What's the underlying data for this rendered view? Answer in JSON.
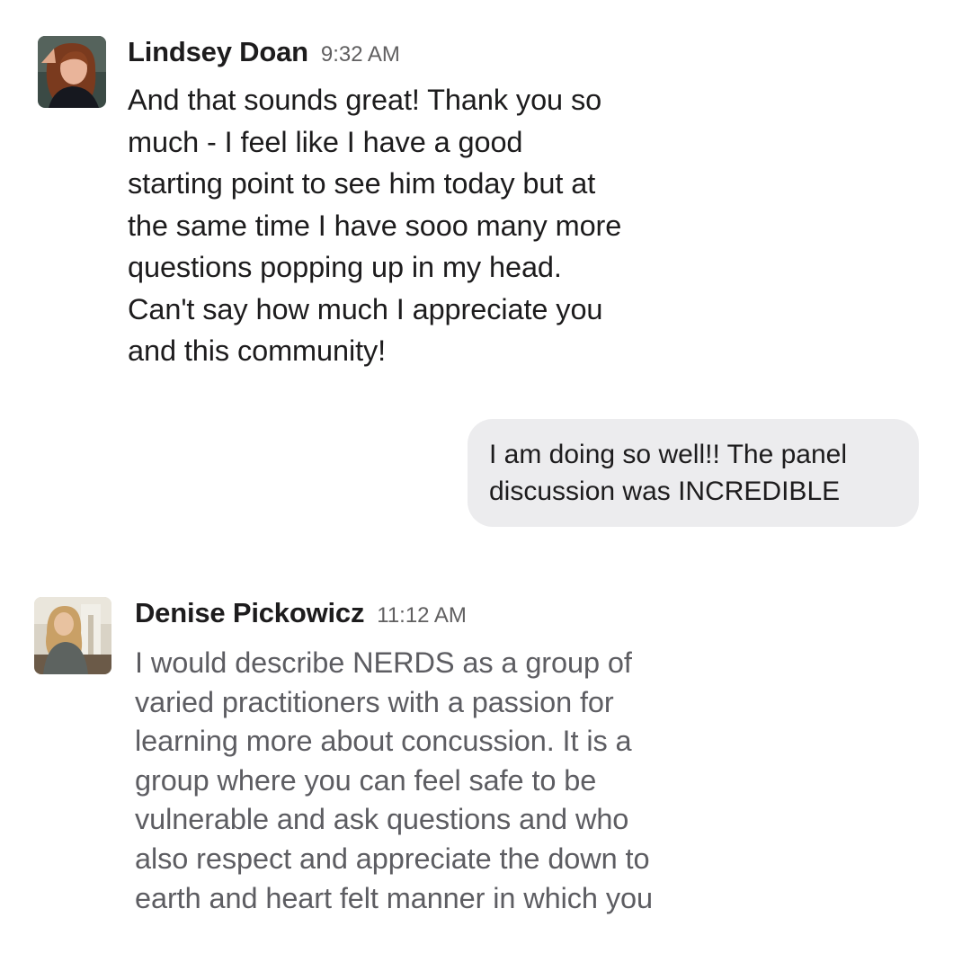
{
  "messages": [
    {
      "author": "Lindsey Doan",
      "time": "9:32 AM",
      "avatar": "profile-photo",
      "text": "And that sounds great! Thank you so\nmuch - I feel like I have a good\nstarting point to see him today but at\nthe same time I have sooo many more\nquestions popping up in my head.\nCan't say how much I appreciate you\nand this community!"
    },
    {
      "author": "Denise Pickowicz",
      "time": "11:12 AM",
      "avatar": "profile-photo",
      "text": "I would describe NERDS as a group of\nvaried practitioners with a passion for\nlearning more about concussion. It is a\ngroup where you can feel safe to be\nvulnerable and ask questions and who\nalso respect and appreciate the down to\nearth and heart felt manner in which you"
    }
  ],
  "reply_bubble": {
    "text": "I am doing so well!! The panel\ndiscussion was INCREDIBLE",
    "background": "#ececee"
  },
  "colors": {
    "text_dark": "#1d1c1d",
    "text_faded": "#5d5d62",
    "timestamp": "#616061"
  }
}
